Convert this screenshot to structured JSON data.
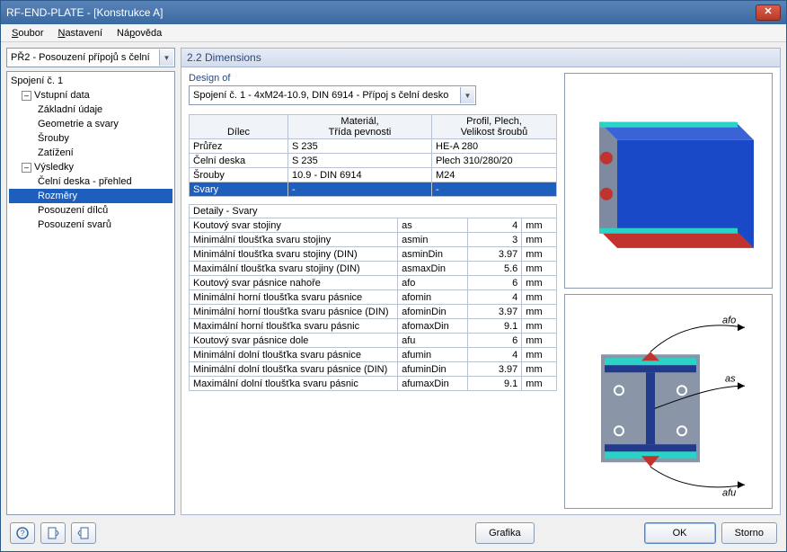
{
  "window": {
    "title": "RF-END-PLATE - [Konstrukce A]"
  },
  "menu": {
    "soubor": "Soubor",
    "nastaveni": "Nastavení",
    "napoveda": "Nápověda"
  },
  "left_combo": "PŘ2 - Posouzení přípojů s čelní",
  "tree": {
    "root": "Spojení č. 1",
    "group1": "Vstupní data",
    "g1_items": [
      "Základní údaje",
      "Geometrie a svary",
      "Šrouby",
      "Zatížení"
    ],
    "group2": "Výsledky",
    "g2_items": [
      "Čelní deska - přehled",
      "Rozměry",
      "Posouzení dílců",
      "Posouzení svarů"
    ],
    "selected": "Rozměry"
  },
  "section_title": "2.2 Dimensions",
  "design_label": "Design of",
  "design_value": "Spojení č. 1 - 4xM24-10.9, DIN 6914 - Přípoj s čelní desko",
  "grid_headers": {
    "c1": "Dílec",
    "c2a": "Materiál,",
    "c2b": "Třída pevnosti",
    "c3a": "Profil, Plech,",
    "c3b": "Velikost šroubů"
  },
  "grid_rows": [
    {
      "dil": "Průřez",
      "mat": "S 235",
      "prof": "HE-A 280"
    },
    {
      "dil": "Čelní deska",
      "mat": "S 235",
      "prof": "Plech 310/280/20"
    },
    {
      "dil": "Šrouby",
      "mat": "10.9 - DIN 6914",
      "prof": "M24"
    },
    {
      "dil": "Svary",
      "mat": "-",
      "prof": "-"
    }
  ],
  "details_caption": "Detaily  -  Svary",
  "details": [
    {
      "d": "Koutový svar stojiny",
      "sym": "as",
      "val": "4",
      "u": "mm"
    },
    {
      "d": "Minimální tloušťka svaru stojiny",
      "sym": "asmin",
      "val": "3",
      "u": "mm"
    },
    {
      "d": "Minimální tloušťka svaru stojiny (DIN)",
      "sym": "asminDin",
      "val": "3.97",
      "u": "mm"
    },
    {
      "d": "Maximální tloušťka svaru stojiny (DIN)",
      "sym": "asmaxDin",
      "val": "5.6",
      "u": "mm"
    },
    {
      "d": "Koutový svar pásnice nahoře",
      "sym": "afo",
      "val": "6",
      "u": "mm"
    },
    {
      "d": "Minimální horní tloušťka svaru pásnice",
      "sym": "afomin",
      "val": "4",
      "u": "mm"
    },
    {
      "d": "Minimální horní tloušťka svaru pásnice (DIN)",
      "sym": "afominDin",
      "val": "3.97",
      "u": "mm"
    },
    {
      "d": "Maximální horní tloušťka svaru pásnic",
      "sym": "afomaxDin",
      "val": "9.1",
      "u": "mm"
    },
    {
      "d": "Koutový svar pásnice dole",
      "sym": "afu",
      "val": "6",
      "u": "mm"
    },
    {
      "d": "Minimální dolní tloušťka svaru pásnice",
      "sym": "afumin",
      "val": "4",
      "u": "mm"
    },
    {
      "d": "Minimální dolní tloušťka svaru pásnice (DIN)",
      "sym": "afuminDin",
      "val": "3.97",
      "u": "mm"
    },
    {
      "d": "Maximální dolní tloušťka svaru pásnic",
      "sym": "afumaxDin",
      "val": "9.1",
      "u": "mm"
    }
  ],
  "diagram_labels": {
    "afo": "afo",
    "as": "as",
    "afu": "afu"
  },
  "buttons": {
    "grafika": "Grafika",
    "ok": "OK",
    "storno": "Storno"
  }
}
